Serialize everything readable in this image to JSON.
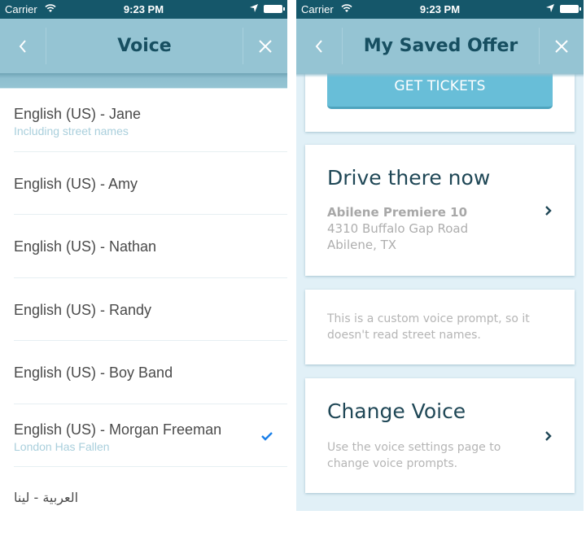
{
  "status_bar": {
    "carrier": "Carrier",
    "time": "9:23 PM",
    "icons": [
      "wifi-icon",
      "location-arrow-icon",
      "battery-icon"
    ]
  },
  "left_screen": {
    "nav": {
      "title": "Voice",
      "back_icon": "chevron-left-icon",
      "close_icon": "close-icon"
    },
    "voices": [
      {
        "name": "English (US) - Jane",
        "subtitle": "Including street names",
        "selected": false
      },
      {
        "name": "English (US) - Amy",
        "subtitle": "",
        "selected": false
      },
      {
        "name": "English (US) - Nathan",
        "subtitle": "",
        "selected": false
      },
      {
        "name": "English (US) - Randy",
        "subtitle": "",
        "selected": false
      },
      {
        "name": "English (US) - Boy Band",
        "subtitle": "",
        "selected": false
      },
      {
        "name": "English (US) - Morgan Freeman",
        "subtitle": "London Has Fallen",
        "selected": true
      },
      {
        "name": "العربية - لينا",
        "subtitle": "",
        "selected": false
      }
    ]
  },
  "right_screen": {
    "nav": {
      "title": "My Saved Offer",
      "back_icon": "chevron-left-icon",
      "close_icon": "close-icon"
    },
    "get_tickets_label": "GET TICKETS",
    "drive_card": {
      "heading": "Drive there now",
      "venue": "Abilene Premiere 10",
      "address_line1": "4310 Buffalo Gap Road",
      "address_line2": "Abilene, TX"
    },
    "note_card": {
      "text": "This is a custom voice prompt, so it doesn't read street names."
    },
    "change_voice_card": {
      "heading": "Change Voice",
      "description": "Use the voice settings page to change voice prompts."
    }
  },
  "colors": {
    "status_bar": "#15576a",
    "nav_bar": "#95c4d3",
    "nav_title": "#174f61",
    "accent_button": "#68bed8",
    "checkmark": "#1a7fe8",
    "subtitle": "#a9cfdc",
    "content_bg": "#e1f0f7"
  }
}
